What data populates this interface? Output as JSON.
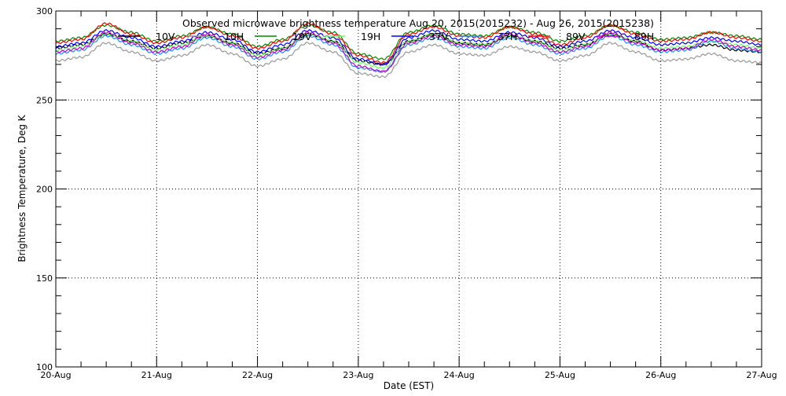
{
  "chart_data": {
    "type": "line",
    "title": "Observed microwave brightness temperature Aug 20, 2015(2015232) - Aug 26, 2015(2015238)",
    "xlabel": "Date (EST)",
    "ylabel": "Brightness Temperature, Deg K",
    "xlim": [
      0,
      7
    ],
    "ylim": [
      100,
      300
    ],
    "grid": true,
    "legend_position": "top",
    "x_unit": "days since 20-Aug 00:00",
    "x_tick_labels": [
      "20-Aug",
      "21-Aug",
      "22-Aug",
      "23-Aug",
      "24-Aug",
      "25-Aug",
      "26-Aug",
      "27-Aug"
    ],
    "y_ticks": [
      100,
      150,
      200,
      250,
      300
    ],
    "x": [
      0,
      0.25,
      0.5,
      0.75,
      1,
      1.25,
      1.5,
      1.75,
      2,
      2.25,
      2.5,
      2.75,
      3,
      3.25,
      3.5,
      3.75,
      4,
      4.25,
      4.5,
      4.75,
      5,
      5.25,
      5.5,
      5.75,
      6,
      6.25,
      6.5,
      6.75,
      7
    ],
    "series": [
      {
        "name": "10V",
        "color": "#000000",
        "values": [
          279,
          281,
          287,
          283,
          279,
          282,
          286,
          282,
          276,
          279,
          287,
          283,
          272,
          270,
          283,
          287,
          282,
          281,
          286,
          283,
          279,
          281,
          287,
          283,
          278,
          279,
          281,
          278,
          277
        ]
      },
      {
        "name": "10H",
        "color": "#999999",
        "values": [
          272,
          274,
          282,
          277,
          272,
          275,
          281,
          276,
          269,
          273,
          282,
          277,
          265,
          263,
          277,
          281,
          276,
          275,
          280,
          277,
          272,
          275,
          282,
          277,
          272,
          273,
          276,
          272,
          271
        ]
      },
      {
        "name": "19V",
        "color": "#008800",
        "values": [
          283,
          285,
          292,
          288,
          283,
          286,
          291,
          287,
          280,
          284,
          292,
          288,
          276,
          273,
          288,
          292,
          287,
          286,
          291,
          288,
          283,
          286,
          292,
          288,
          284,
          285,
          288,
          286,
          284
        ]
      },
      {
        "name": "19H",
        "color": "#66ff66",
        "values": [
          278,
          280,
          287,
          283,
          278,
          281,
          286,
          282,
          275,
          279,
          287,
          283,
          271,
          268,
          283,
          287,
          282,
          281,
          286,
          283,
          278,
          281,
          287,
          283,
          279,
          280,
          283,
          281,
          279
        ]
      },
      {
        "name": "37V",
        "color": "#0000ff",
        "values": [
          280,
          282,
          289,
          285,
          280,
          283,
          288,
          284,
          277,
          281,
          289,
          285,
          273,
          270,
          285,
          289,
          284,
          283,
          288,
          285,
          280,
          283,
          289,
          285,
          281,
          282,
          285,
          283,
          281
        ]
      },
      {
        "name": "37H",
        "color": "#1e90ff",
        "values": [
          276,
          278,
          286,
          281,
          276,
          279,
          285,
          280,
          273,
          277,
          286,
          281,
          268,
          266,
          281,
          285,
          280,
          279,
          285,
          281,
          276,
          279,
          286,
          281,
          277,
          278,
          283,
          279,
          277
        ]
      },
      {
        "name": "89V",
        "color": "#ff0000",
        "values": [
          282,
          284,
          293,
          287,
          282,
          285,
          291,
          286,
          279,
          283,
          293,
          287,
          275,
          271,
          287,
          291,
          286,
          285,
          291,
          287,
          281,
          285,
          292,
          287,
          283,
          284,
          288,
          285,
          283
        ]
      },
      {
        "name": "89H",
        "color": "#cc00cc",
        "values": [
          277,
          279,
          288,
          282,
          277,
          280,
          287,
          281,
          274,
          278,
          288,
          282,
          269,
          266,
          282,
          286,
          281,
          280,
          287,
          282,
          277,
          280,
          288,
          282,
          278,
          279,
          284,
          280,
          278
        ]
      }
    ]
  }
}
